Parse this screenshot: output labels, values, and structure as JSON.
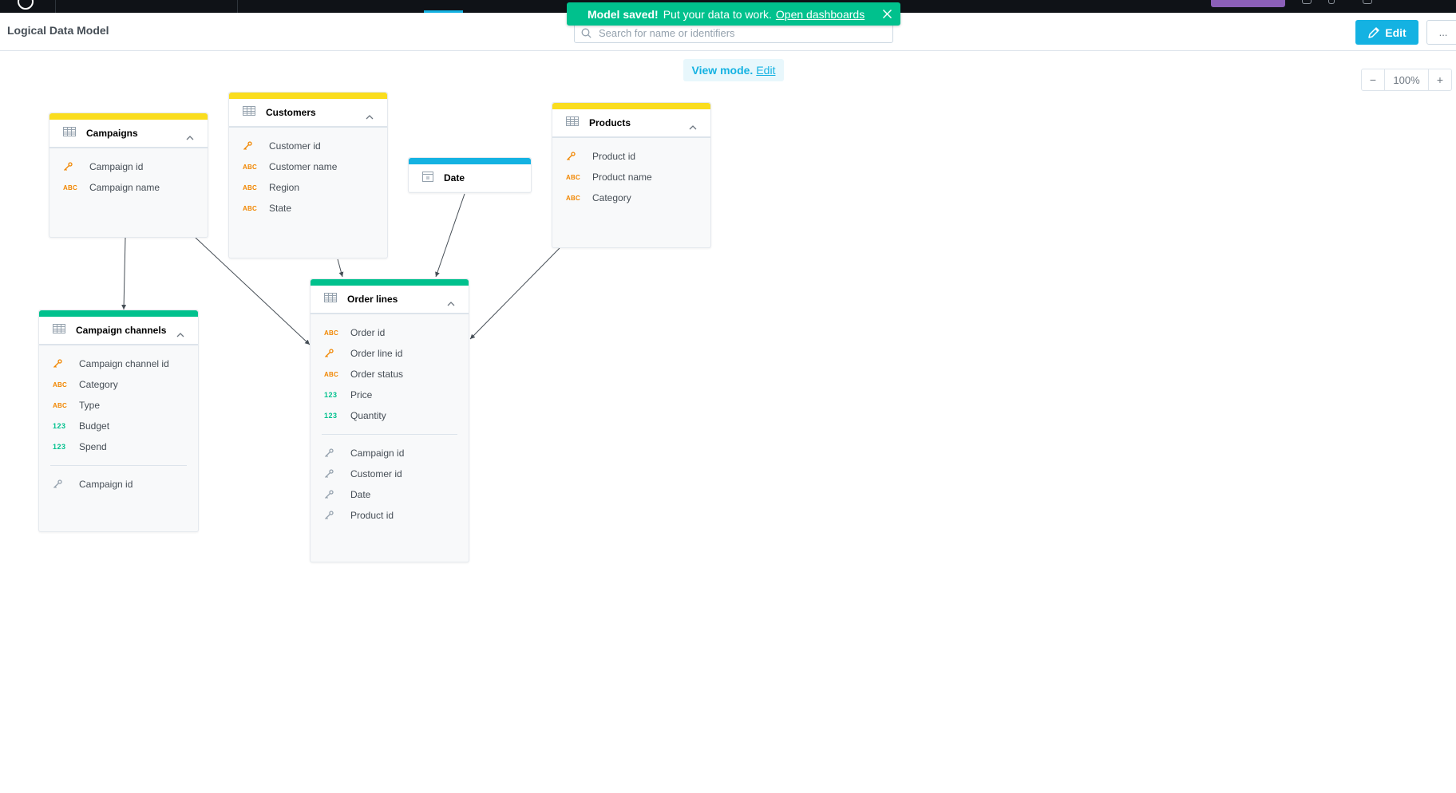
{
  "header": {
    "title": "Logical Data Model",
    "search_placeholder": "Search for name or identifiers",
    "edit_label": "Edit",
    "more_label": "..."
  },
  "toast": {
    "title": "Model saved!",
    "message": "Put your data to work.",
    "link": "Open dashboards"
  },
  "view_mode": {
    "label": "View mode.",
    "edit_link": "Edit"
  },
  "zoom": {
    "minus": "−",
    "value": "100%",
    "plus": "+"
  },
  "datasets": {
    "campaigns": {
      "title": "Campaigns",
      "color": "#fadd1e",
      "fields": [
        {
          "type": "key",
          "name": "Campaign id"
        },
        {
          "type": "abc",
          "name": "Campaign name"
        }
      ],
      "refs": []
    },
    "customers": {
      "title": "Customers",
      "color": "#fadd1e",
      "fields": [
        {
          "type": "key",
          "name": "Customer id"
        },
        {
          "type": "abc",
          "name": "Customer name"
        },
        {
          "type": "abc",
          "name": "Region"
        },
        {
          "type": "abc",
          "name": "State"
        }
      ],
      "refs": []
    },
    "date": {
      "title": "Date",
      "color": "#14b2e2"
    },
    "products": {
      "title": "Products",
      "color": "#fadd1e",
      "fields": [
        {
          "type": "key",
          "name": "Product id"
        },
        {
          "type": "abc",
          "name": "Product name"
        },
        {
          "type": "abc",
          "name": "Category"
        }
      ],
      "refs": []
    },
    "campaign_channels": {
      "title": "Campaign channels",
      "color": "#00c18d",
      "fields": [
        {
          "type": "key",
          "name": "Campaign channel id"
        },
        {
          "type": "abc",
          "name": "Category"
        },
        {
          "type": "abc",
          "name": "Type"
        },
        {
          "type": "num",
          "name": "Budget"
        },
        {
          "type": "num",
          "name": "Spend"
        }
      ],
      "refs": [
        {
          "type": "ref",
          "name": "Campaign id"
        }
      ]
    },
    "order_lines": {
      "title": "Order lines",
      "color": "#00c18d",
      "fields": [
        {
          "type": "abc",
          "name": "Order id"
        },
        {
          "type": "key",
          "name": "Order line id"
        },
        {
          "type": "abc",
          "name": "Order status"
        },
        {
          "type": "num",
          "name": "Price"
        },
        {
          "type": "num",
          "name": "Quantity"
        }
      ],
      "refs": [
        {
          "type": "ref",
          "name": "Campaign id"
        },
        {
          "type": "ref",
          "name": "Customer id"
        },
        {
          "type": "ref",
          "name": "Date"
        },
        {
          "type": "ref",
          "name": "Product id"
        }
      ]
    }
  },
  "badges": {
    "abc": "ABC",
    "num": "123"
  }
}
